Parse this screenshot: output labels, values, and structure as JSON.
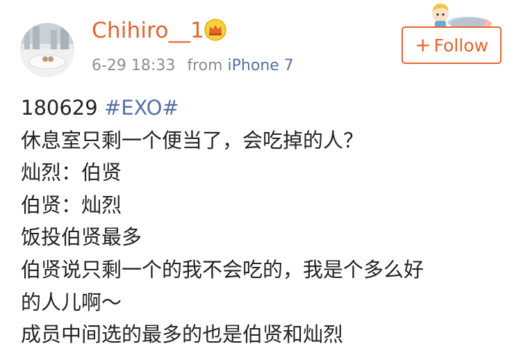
{
  "user": {
    "name": "Chihiro__11",
    "avatar_icon": "profile-photo",
    "badge_icon": "crown-icon"
  },
  "meta": {
    "date": "6-29 18:33",
    "from_label": "from",
    "source": "iPhone 7"
  },
  "follow": {
    "plus": "+",
    "label": "Follow"
  },
  "post": {
    "date_prefix": "180629",
    "hashtag": "#EXO#",
    "lines": [
      "休息室只剩一个便当了，会吃掉的人？",
      "灿烈：伯贤",
      "伯贤：灿烈",
      "饭投伯贤最多",
      "伯贤说只剩一个的我不会吃的，我是个多么好",
      "的人儿啊～",
      "成员中间选的最多的也是伯贤和灿烈"
    ]
  },
  "colors": {
    "accent": "#e8622b",
    "link": "#5470a8",
    "meta": "#8c8c8c",
    "text": "#222222"
  }
}
